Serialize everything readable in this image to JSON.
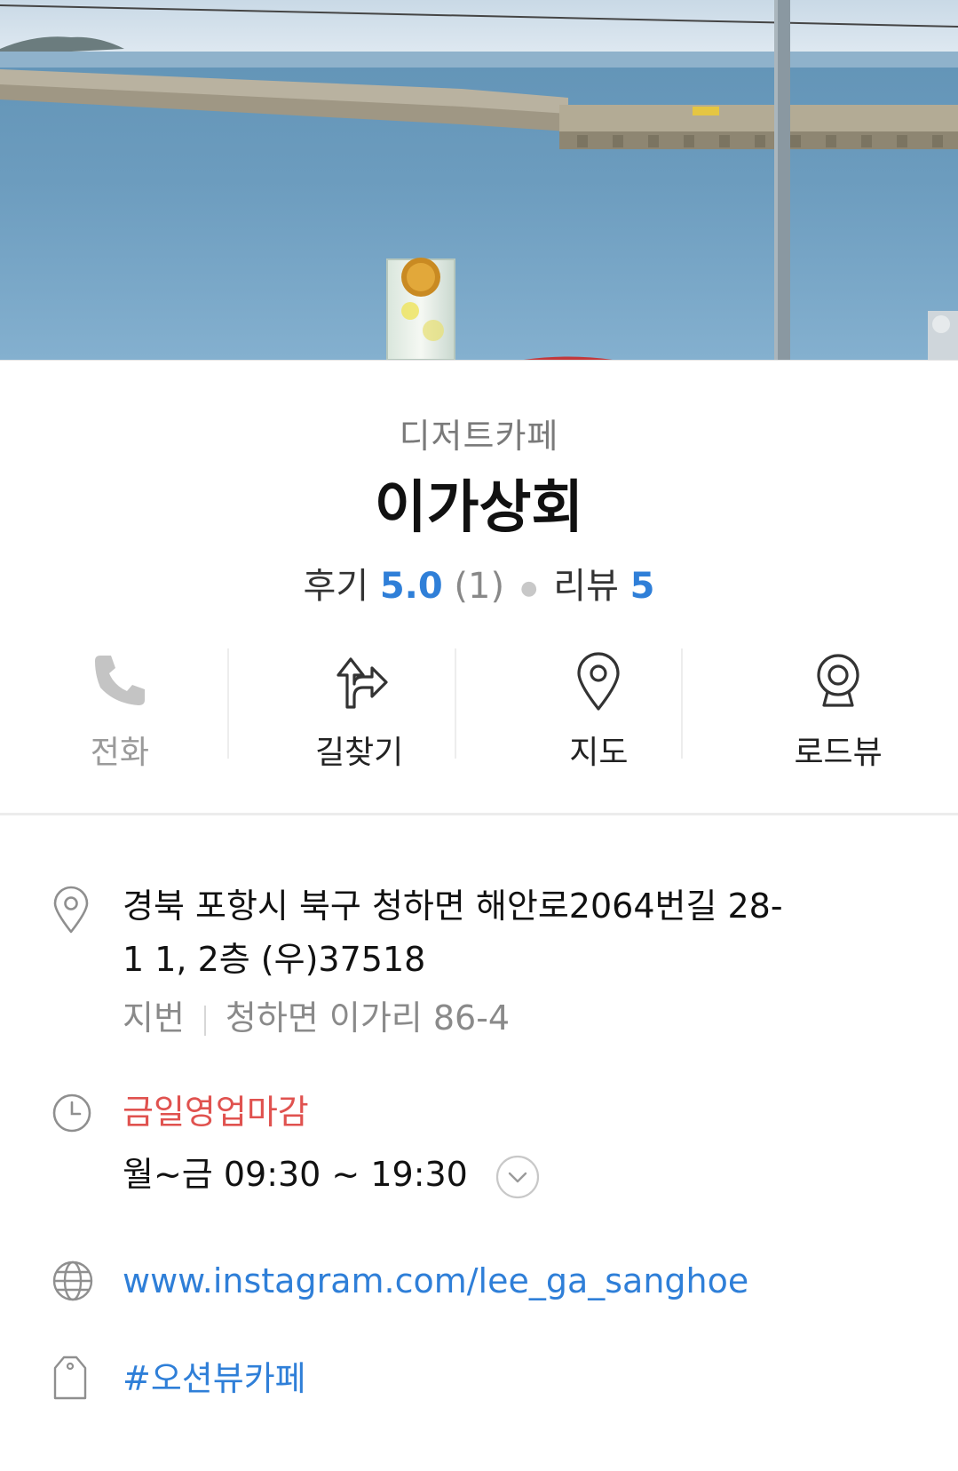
{
  "place": {
    "category": "디저트카페",
    "name": "이가상회",
    "review_label": "후기",
    "review_score": "5.0",
    "review_count": "(1)",
    "blog_review_label": "리뷰",
    "blog_review_count": "5"
  },
  "actions": [
    {
      "label": "전화",
      "icon": "phone-icon",
      "enabled": false
    },
    {
      "label": "길찾기",
      "icon": "directions-icon",
      "enabled": true
    },
    {
      "label": "지도",
      "icon": "map-pin-icon",
      "enabled": true
    },
    {
      "label": "로드뷰",
      "icon": "roadview-camera-icon",
      "enabled": true
    }
  ],
  "address": {
    "road_line1": "경북 포항시 북구 청하면 해안로2064번길 28-",
    "road_line2": "1 1, 2층 (우)37518",
    "jibun_label": "지번",
    "jibun_value": "청하면 이가리 86-4"
  },
  "hours": {
    "status": "금일영업마감",
    "schedule": "월~금 09:30 ~ 19:30"
  },
  "website": "www.instagram.com/lee_ga_sanghoe",
  "tag": "#오션뷰카페",
  "colors": {
    "accent": "#2f7fd8",
    "closed": "#e0524f",
    "muted": "#8a8a8a"
  }
}
